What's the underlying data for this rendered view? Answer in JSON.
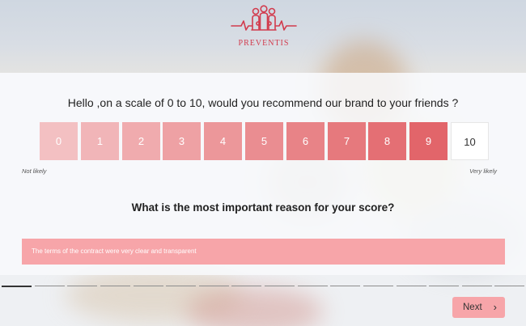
{
  "brand": {
    "name": "PREVENTIS",
    "color": "#d23b4d"
  },
  "question1": "Hello ,on a scale of 0 to 10, would you recommend our brand to your friends ?",
  "scale": {
    "options": [
      "0",
      "1",
      "2",
      "3",
      "4",
      "5",
      "6",
      "7",
      "8",
      "9",
      "10"
    ],
    "colors": [
      "#f3c0c2",
      "#f1b5b8",
      "#f0abae",
      "#eea1a4",
      "#ec979a",
      "#ea8d91",
      "#e88387",
      "#e6797d",
      "#e46f74",
      "#e2656a",
      "#ffffff"
    ],
    "selected": "10",
    "label_min": "Not likely",
    "label_max": "Very likely"
  },
  "question2": "What is the most important reason for your score?",
  "answer": {
    "value": "The terms of the contract were very clear and transparent",
    "background": "#f7a5a9"
  },
  "progress": {
    "segments": 16,
    "completed": 1
  },
  "next_button": {
    "label": "Next",
    "icon": "chevron-right-icon"
  }
}
